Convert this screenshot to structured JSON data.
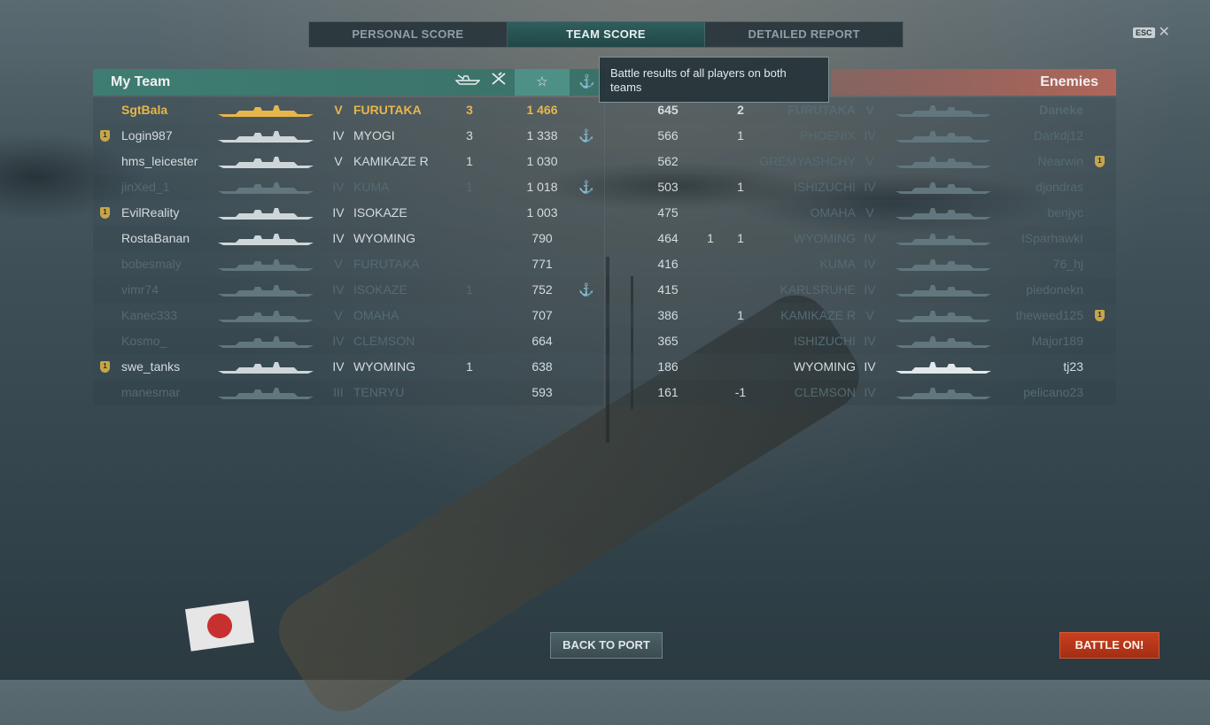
{
  "tabs": [
    {
      "label": "PERSONAL SCORE",
      "active": false
    },
    {
      "label": "TEAM SCORE",
      "active": true
    },
    {
      "label": "DETAILED REPORT",
      "active": false
    }
  ],
  "esc_label": "ESC",
  "my_team": {
    "title": "My Team",
    "column_icons": [
      "ship-kills-icon",
      "plane-kills-icon",
      "star-icon",
      "anchor-icon"
    ]
  },
  "enemies": {
    "title": "Enemies"
  },
  "tooltip": "Battle results of all players on both teams",
  "colors": {
    "my_team_header": "#3e7d72",
    "enemy_header": "#b0665a",
    "highlight": "#e7b64a",
    "battle_button": "#c8401e"
  },
  "my_players": [
    {
      "name": "SgtBala",
      "tier": "V",
      "ship": "FURUTAKA",
      "kills": "3",
      "score": "1 466",
      "anchor": "",
      "badge": "",
      "state": "me"
    },
    {
      "name": "Login987",
      "tier": "IV",
      "ship": "MYOGI",
      "kills": "3",
      "score": "1 338",
      "anchor": "⚓",
      "badge": "1",
      "state": "alive"
    },
    {
      "name": "hms_leicester",
      "tier": "V",
      "ship": "KAMIKAZE R",
      "kills": "1",
      "score": "1 030",
      "anchor": "",
      "badge": "",
      "state": "alive"
    },
    {
      "name": "jinXed_1",
      "tier": "IV",
      "ship": "KUMA",
      "kills": "1",
      "score": "1 018",
      "anchor": "⚓",
      "badge": "",
      "state": "dim"
    },
    {
      "name": "EvilReality",
      "tier": "IV",
      "ship": "ISOKAZE",
      "kills": "",
      "score": "1 003",
      "anchor": "",
      "badge": "1",
      "state": "alive"
    },
    {
      "name": "RostaBanan",
      "tier": "IV",
      "ship": "WYOMING",
      "kills": "",
      "score": "790",
      "anchor": "",
      "badge": "",
      "state": "alive"
    },
    {
      "name": "bobesmaly",
      "tier": "V",
      "ship": "FURUTAKA",
      "kills": "",
      "score": "771",
      "anchor": "",
      "badge": "",
      "state": "dim"
    },
    {
      "name": "vimr74",
      "tier": "IV",
      "ship": "ISOKAZE",
      "kills": "1",
      "score": "752",
      "anchor": "⚓",
      "badge": "",
      "state": "dim"
    },
    {
      "name": "Kanec333",
      "tier": "V",
      "ship": "OMAHA",
      "kills": "",
      "score": "707",
      "anchor": "",
      "badge": "",
      "state": "dim"
    },
    {
      "name": "Kosmo_",
      "tier": "IV",
      "ship": "CLEMSON",
      "kills": "",
      "score": "664",
      "anchor": "",
      "badge": "",
      "state": "dim"
    },
    {
      "name": "swe_tanks",
      "tier": "IV",
      "ship": "WYOMING",
      "kills": "1",
      "score": "638",
      "anchor": "",
      "badge": "1",
      "state": "alive"
    },
    {
      "name": "manesmar",
      "tier": "III",
      "ship": "TENRYU",
      "kills": "",
      "score": "593",
      "anchor": "",
      "badge": "",
      "state": "dim"
    }
  ],
  "enemy_players": [
    {
      "score": "645",
      "planes": "",
      "kills": "2",
      "ship": "FURUTAKA",
      "tier": "V",
      "name": "Daneke",
      "badge": "",
      "state": "dim"
    },
    {
      "score": "566",
      "planes": "",
      "kills": "1",
      "ship": "PHOENIX",
      "tier": "IV",
      "name": "Darkdj12",
      "badge": "",
      "state": "dim"
    },
    {
      "score": "562",
      "planes": "",
      "kills": "",
      "ship": "GREMYASHCHY",
      "tier": "V",
      "name": "Nearwin",
      "badge": "1",
      "state": "dim"
    },
    {
      "score": "503",
      "planes": "",
      "kills": "1",
      "ship": "ISHIZUCHI",
      "tier": "IV",
      "name": "djondras",
      "badge": "",
      "state": "dim"
    },
    {
      "score": "475",
      "planes": "",
      "kills": "",
      "ship": "OMAHA",
      "tier": "V",
      "name": "benjyc",
      "badge": "",
      "state": "dim"
    },
    {
      "score": "464",
      "planes": "1",
      "kills": "1",
      "ship": "WYOMING",
      "tier": "IV",
      "name": "ISparhawkI",
      "badge": "",
      "state": "dim"
    },
    {
      "score": "416",
      "planes": "",
      "kills": "",
      "ship": "KUMA",
      "tier": "IV",
      "name": "76_hj",
      "badge": "",
      "state": "dim"
    },
    {
      "score": "415",
      "planes": "",
      "kills": "",
      "ship": "KARLSRUHE",
      "tier": "IV",
      "name": "piedonekn",
      "badge": "",
      "state": "dim"
    },
    {
      "score": "386",
      "planes": "",
      "kills": "1",
      "ship": "KAMIKAZE R",
      "tier": "V",
      "name": "theweed125",
      "badge": "1",
      "state": "dim"
    },
    {
      "score": "365",
      "planes": "",
      "kills": "",
      "ship": "ISHIZUCHI",
      "tier": "IV",
      "name": "Major189",
      "badge": "",
      "state": "dim"
    },
    {
      "score": "186",
      "planes": "",
      "kills": "",
      "ship": "WYOMING",
      "tier": "IV",
      "name": "tj23",
      "badge": "",
      "state": "alive"
    },
    {
      "score": "161",
      "planes": "",
      "kills": "-1",
      "ship": "CLEMSON",
      "tier": "IV",
      "name": "pelicano23",
      "badge": "",
      "state": "dim"
    }
  ],
  "buttons": {
    "back_to_port": "BACK TO PORT",
    "battle_on": "BATTLE ON!"
  }
}
